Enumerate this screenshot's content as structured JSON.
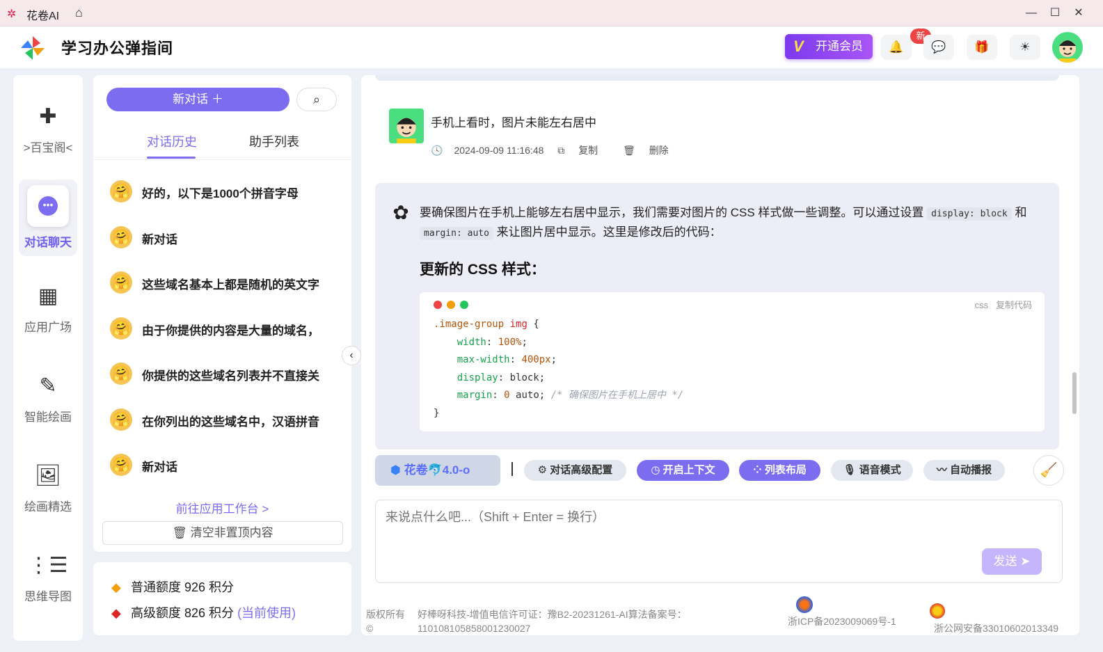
{
  "titlebar": {
    "app_name": "花卷AI"
  },
  "header": {
    "title": "学习办公弹指间",
    "vip_label": "开通会员",
    "notify_badge": "新"
  },
  "nav": {
    "items": [
      {
        "label": ">百宝阁<"
      },
      {
        "label": "对话聊天"
      },
      {
        "label": "应用广场"
      },
      {
        "label": "智能绘画"
      },
      {
        "label": "绘画精选"
      },
      {
        "label": "思维导图"
      }
    ]
  },
  "sidebar": {
    "new_chat": "新对话 ＋",
    "tabs": [
      "对话历史",
      "助手列表"
    ],
    "conversations": [
      "好的，以下是1000个拼音字母",
      "新对话",
      "这些域名基本上都是随机的英文字",
      "由于你提供的内容是大量的域名，",
      "你提供的这些域名列表并不直接关",
      "在你列出的这些域名中，汉语拼音",
      "新对话"
    ],
    "goto_link": "前往应用工作台 >",
    "clear_label": "清空非置顶内容"
  },
  "credits": {
    "normal": "普通额度 926 积分",
    "premium": "高级额度 826 积分",
    "current": "(当前使用)"
  },
  "chat": {
    "user_message": "手机上看时，图片未能左右居中",
    "timestamp": "2024-09-09 11:16:48",
    "copy_label": "复制",
    "delete_label": "删除",
    "ai_text_1": "要确保图片在手机上能够左右居中显示，我们需要对图片的 CSS 样式做一些调整。可以通过设置",
    "ai_code_1": "display: block",
    "ai_text_2": "和",
    "ai_code_2": "margin: auto",
    "ai_text_3": "来让图片居中显示。这里是修改后的代码：",
    "ai_heading": "更新的 CSS 样式：",
    "code_lang": "css",
    "code_copy": "复制代码",
    "code": {
      "selector": ".image-group",
      "tag": "img",
      "open": " {",
      "l1_prop": "width",
      "l1_val": "100%",
      "l2_prop": "max-width",
      "l2_val": "400px",
      "l3_prop": "display",
      "l3_val": "block",
      "l4_prop": "margin",
      "l4_num": "0",
      "l4_val": "auto",
      "l4_comment": "/* 确保图片在手机上居中 */",
      "close": "}"
    }
  },
  "toolbar": {
    "model": "花卷🐬4.0-o",
    "advanced": "对话高级配置",
    "context": "开启上下文",
    "layout": "列表布局",
    "voice": "语音模式",
    "autoplay": "自动播报"
  },
  "input": {
    "placeholder": "来说点什么吧...（Shift + Enter = 换行）",
    "send": "发送"
  },
  "footer": {
    "copyright": "版权所有",
    "copyright_sym": "©",
    "company": "好棒呀科技-增值电信许可证：豫B2-20231261-AI算法备案号：",
    "algo_no": "110108105858001230027",
    "icp": "浙ICP备2023009069号-1",
    "police": "浙公网安备33010602013349"
  },
  "colors": {
    "accent": "#7c6cf0",
    "vip": "#7c3aed",
    "badge": "#ef4444"
  }
}
